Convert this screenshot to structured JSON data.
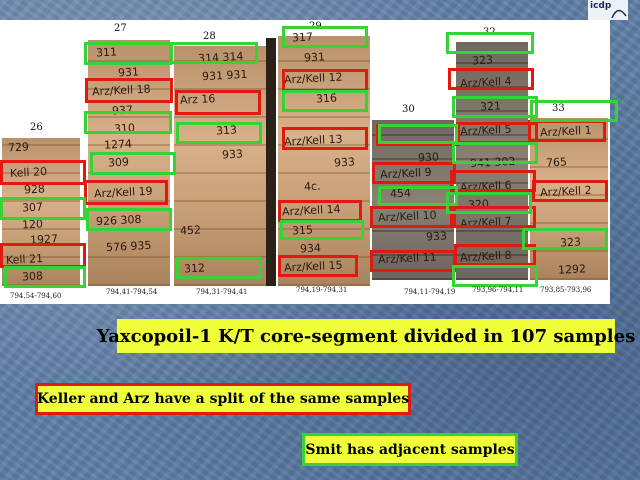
{
  "logo": {
    "text": "icdp"
  },
  "segments": [
    {
      "number": "26",
      "depth": "794,54-794,60"
    },
    {
      "number": "27",
      "depth": "794,41-794,54"
    },
    {
      "number": "28",
      "depth": "794,31-794,41"
    },
    {
      "number": "29",
      "depth": "794,19-794,31"
    },
    {
      "number": "30",
      "depth": "794,11-794,19"
    },
    {
      "number": "32",
      "depth": "793,96-794,11"
    },
    {
      "number": "33",
      "depth": "793,85-793,96"
    }
  ],
  "core_labels": {
    "c26": [
      "729",
      "Kell 20",
      "928",
      "307",
      "120",
      "1927",
      "Kell 21",
      "308"
    ],
    "c27": [
      "311",
      "931",
      "Arz/Kell 18",
      "937",
      "310",
      "1274",
      "309",
      "Arz/Kell 19",
      "926 308",
      "576 935"
    ],
    "c28": [
      "314 314",
      "931 931",
      "Arz 16",
      "313",
      "933",
      "452",
      "312"
    ],
    "c29": [
      "317",
      "931",
      "Arz/Kell 12",
      "316",
      "Arz/Kell 13",
      "933",
      "4c.",
      "Arz/Kell 14",
      "315",
      "934",
      "Arz/Kell 15"
    ],
    "c30": [
      "930",
      "Arz/Kell 9",
      "454",
      "Arz/Kell 10",
      "933",
      "Arz/Kell 11"
    ],
    "c32": [
      "323",
      "Arz/Kell 4",
      "321",
      "Arz/Kell 5",
      "941 302",
      "Arz/Kell 6",
      "320",
      "Arz/Kell 7",
      "Arz/Kell 8"
    ],
    "c33": [
      "Arz/Kell 1",
      "765",
      "Arz/Kell 2",
      "323",
      "1292"
    ]
  },
  "title": "Yaxcopoil-1 K/T core-segment divided in 107 samples",
  "note_red": "Keller and Arz have a split of the same samples",
  "note_green": "Smit has adjacent samples",
  "colors": {
    "adjacent_box": "#33d433",
    "split_box": "#e01a10",
    "banner": "#f0ff3a"
  }
}
